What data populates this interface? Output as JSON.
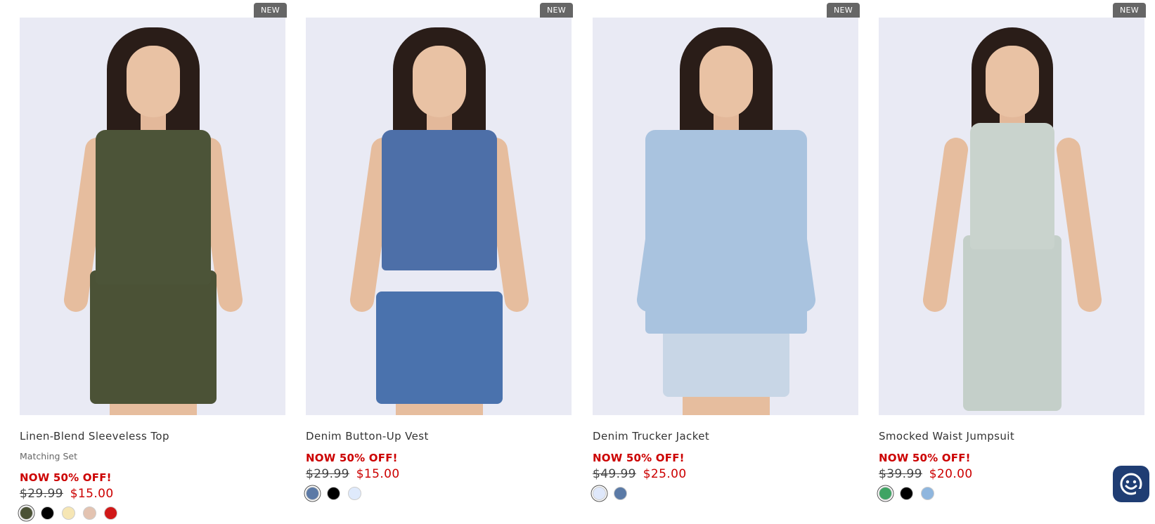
{
  "products": [
    {
      "badge": "NEW",
      "name": "Linen-Blend Sleeveless Top",
      "subtitle": "Matching Set",
      "promo": "NOW 50% OFF!",
      "old_price": "$29.99",
      "new_price": "$15.00",
      "swatches": [
        "#4b5236",
        "#000000",
        "#f6e6b4",
        "#e3c3b1",
        "#d01818"
      ]
    },
    {
      "badge": "NEW",
      "name": "Denim Button-Up Vest",
      "promo": "NOW 50% OFF!",
      "old_price": "$29.99",
      "new_price": "$15.00",
      "swatches": [
        "#5b79a6",
        "#000000",
        "#dfeafc"
      ]
    },
    {
      "badge": "NEW",
      "name": "Denim Trucker Jacket",
      "promo": "NOW 50% OFF!",
      "old_price": "$49.99",
      "new_price": "$25.00",
      "swatches": [
        "#dfe8fb",
        "#5b7aa6"
      ]
    },
    {
      "badge": "NEW",
      "name": "Smocked Waist Jumpsuit",
      "promo": "NOW 50% OFF!",
      "old_price": "$39.99",
      "new_price": "$20.00",
      "swatches": [
        "#3fa464",
        "#000000",
        "#8fb6de"
      ]
    }
  ],
  "chat": {
    "icon": "smiley-chat-icon",
    "color": "#1f3d73"
  }
}
